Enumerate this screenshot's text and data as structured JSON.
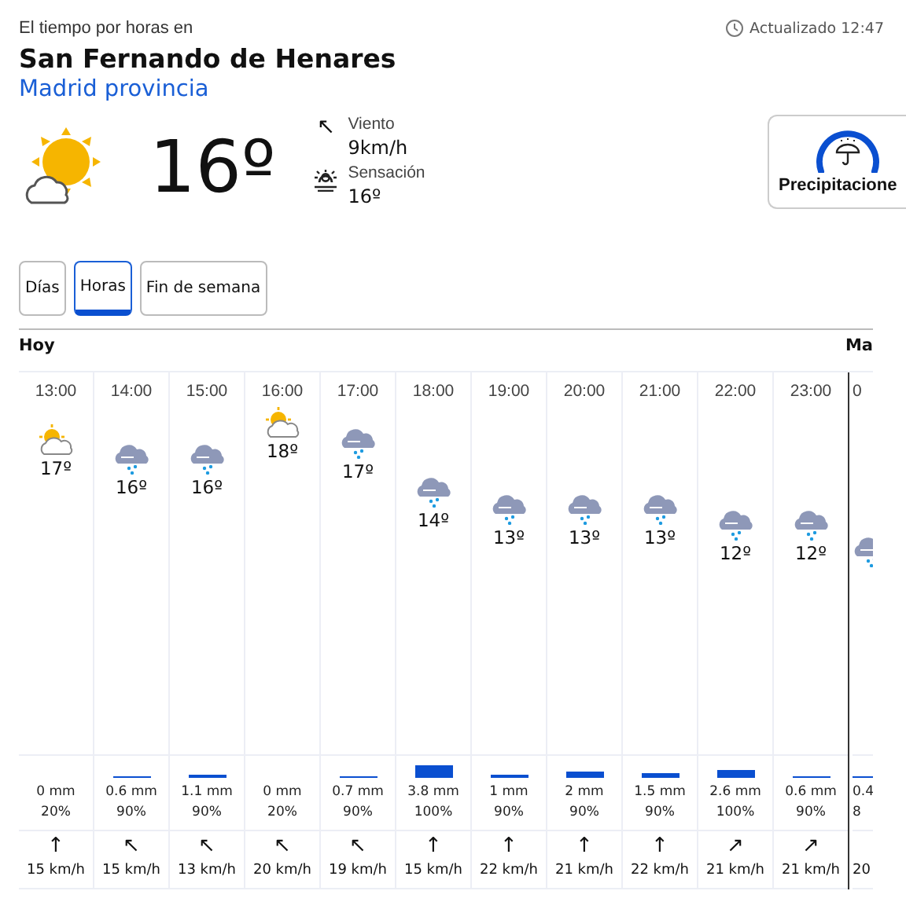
{
  "header": {
    "subtitle": "El tiempo por horas en",
    "city": "San Fernando de Henares",
    "region": "Madrid provincia",
    "updated": "Actualizado 12:47"
  },
  "current": {
    "kind": "sun-cloud",
    "temp": "16º",
    "wind_label": "Viento",
    "wind_value": "9km/h",
    "wind_arrow": "↖",
    "feel_label": "Sensación",
    "feel_value": "16º"
  },
  "card": {
    "label": "Precipitacione"
  },
  "tabs": [
    {
      "label": "Días",
      "selected": false
    },
    {
      "label": "Horas",
      "selected": true
    },
    {
      "label": "Fin de semana",
      "selected": false
    }
  ],
  "days": [
    {
      "label": "Hoy"
    },
    {
      "label": "Ma"
    }
  ],
  "hours": [
    {
      "time": "13:00",
      "kind": "sun-cloud",
      "temp": "17º",
      "rain": "0 mm",
      "prob": "20%",
      "wind_arrow": "↑",
      "wind": "15 km/h"
    },
    {
      "time": "14:00",
      "kind": "rain",
      "temp": "16º",
      "rain": "0.6 mm",
      "prob": "90%",
      "wind_arrow": "↖",
      "wind": "15 km/h"
    },
    {
      "time": "15:00",
      "kind": "rain",
      "temp": "16º",
      "rain": "1.1 mm",
      "prob": "90%",
      "wind_arrow": "↖",
      "wind": "13 km/h"
    },
    {
      "time": "16:00",
      "kind": "sun-cloud",
      "temp": "18º",
      "rain": "0 mm",
      "prob": "20%",
      "wind_arrow": "↖",
      "wind": "20 km/h"
    },
    {
      "time": "17:00",
      "kind": "rain",
      "temp": "17º",
      "rain": "0.7 mm",
      "prob": "90%",
      "wind_arrow": "↖",
      "wind": "19 km/h"
    },
    {
      "time": "18:00",
      "kind": "rain",
      "temp": "14º",
      "rain": "3.8 mm",
      "prob": "100%",
      "wind_arrow": "↑",
      "wind": "15 km/h"
    },
    {
      "time": "19:00",
      "kind": "rain",
      "temp": "13º",
      "rain": "1 mm",
      "prob": "90%",
      "wind_arrow": "↑",
      "wind": "22 km/h"
    },
    {
      "time": "20:00",
      "kind": "rain",
      "temp": "13º",
      "rain": "2 mm",
      "prob": "90%",
      "wind_arrow": "↑",
      "wind": "21 km/h"
    },
    {
      "time": "21:00",
      "kind": "rain",
      "temp": "13º",
      "rain": "1.5 mm",
      "prob": "90%",
      "wind_arrow": "↑",
      "wind": "22 km/h"
    },
    {
      "time": "22:00",
      "kind": "rain",
      "temp": "12º",
      "rain": "2.6 mm",
      "prob": "100%",
      "wind_arrow": "↗",
      "wind": "21 km/h"
    },
    {
      "time": "23:00",
      "kind": "rain",
      "temp": "12º",
      "rain": "0.6 mm",
      "prob": "90%",
      "wind_arrow": "↗",
      "wind": "21 km/h"
    }
  ],
  "next_hour": {
    "time": "0",
    "kind": "rain",
    "rain": "0.4",
    "prob": "8",
    "wind": "20"
  }
}
